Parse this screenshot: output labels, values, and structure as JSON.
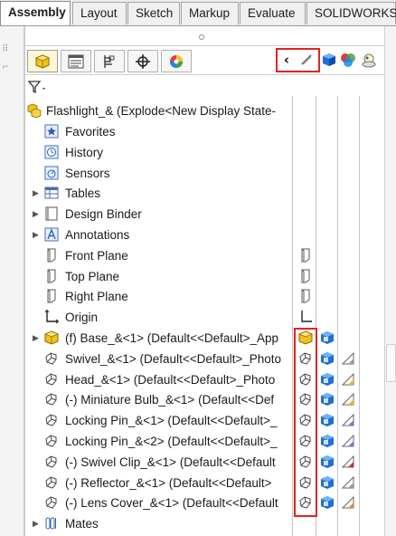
{
  "tabs": [
    "Assembly",
    "Layout",
    "Sketch",
    "Markup",
    "Evaluate",
    "SOLIDWORKS"
  ],
  "active_tab": "Assembly",
  "manager_tabs": [
    {
      "name": "featuremanager-tab-icon",
      "active": true
    },
    {
      "name": "propertymanager-tab-icon",
      "active": false
    },
    {
      "name": "configurationmanager-tab-icon",
      "active": false
    },
    {
      "name": "dimxpertmanager-tab-icon",
      "active": false
    },
    {
      "name": "displaymanager-tab-icon",
      "active": false
    }
  ],
  "header_pane_icons": [
    "collapse-chevron-icon",
    "hide-show-icon",
    "display-mode-icon",
    "appearance-icon",
    "transparency-icon"
  ],
  "tree": {
    "root": "Flashlight_&  (Explode<New Display State-",
    "items": [
      {
        "label": "Favorites",
        "icon": "favorites-icon",
        "indent": 1,
        "expander": false
      },
      {
        "label": "History",
        "icon": "history-icon",
        "indent": 1,
        "expander": false
      },
      {
        "label": "Sensors",
        "icon": "sensors-icon",
        "indent": 1,
        "expander": false
      },
      {
        "label": "Tables",
        "icon": "tables-icon",
        "indent": 1,
        "expander": true
      },
      {
        "label": "Design Binder",
        "icon": "design-binder-icon",
        "indent": 1,
        "expander": true
      },
      {
        "label": "Annotations",
        "icon": "annotations-icon",
        "indent": 1,
        "expander": true
      },
      {
        "label": "Front Plane",
        "icon": "plane-icon",
        "indent": 1,
        "expander": false,
        "col1": "plane"
      },
      {
        "label": "Top Plane",
        "icon": "plane-icon",
        "indent": 1,
        "expander": false,
        "col1": "plane"
      },
      {
        "label": "Right Plane",
        "icon": "plane-icon",
        "indent": 1,
        "expander": false,
        "col1": "plane"
      },
      {
        "label": "Origin",
        "icon": "origin-icon",
        "indent": 1,
        "expander": false,
        "col1": "origin"
      },
      {
        "label": "(f) Base_&<1> (Default<<Default>_App",
        "icon": "part-fixed-icon",
        "indent": 1,
        "expander": true,
        "col1": "part-yellow",
        "col2": "cube",
        "col3": ""
      },
      {
        "label": "Swivel_&<1> (Default<<Default>_Photo",
        "icon": "part-icon",
        "indent": 1,
        "expander": false,
        "col1": "part",
        "col2": "cube",
        "col3": "tri-gray"
      },
      {
        "label": "Head_&<1> (Default<<Default>_Photo",
        "icon": "part-icon",
        "indent": 1,
        "expander": false,
        "col1": "part",
        "col2": "cube",
        "col3": "tri-yellow"
      },
      {
        "label": "(-) Miniature Bulb_&<1> (Default<<Def",
        "icon": "part-icon",
        "indent": 1,
        "expander": false,
        "col1": "part",
        "col2": "cube",
        "col3": "tri-yellow"
      },
      {
        "label": "Locking Pin_&<1> (Default<<Default>_",
        "icon": "part-icon",
        "indent": 1,
        "expander": false,
        "col1": "part",
        "col2": "cube",
        "col3": "tri-purple"
      },
      {
        "label": "Locking Pin_&<2> (Default<<Default>_",
        "icon": "part-icon",
        "indent": 1,
        "expander": false,
        "col1": "part",
        "col2": "cube",
        "col3": "tri-purple"
      },
      {
        "label": "(-) Swivel Clip_&<1> (Default<<Default",
        "icon": "part-icon",
        "indent": 1,
        "expander": false,
        "col1": "part",
        "col2": "cube",
        "col3": "tri-red"
      },
      {
        "label": "(-) Reflector_&<1> (Default<<Default>",
        "icon": "part-icon",
        "indent": 1,
        "expander": false,
        "col1": "part",
        "col2": "cube",
        "col3": "tri-gray"
      },
      {
        "label": "(-) Lens Cover_&<1> (Default<<Default",
        "icon": "part-icon",
        "indent": 1,
        "expander": false,
        "col1": "part",
        "col2": "cube",
        "col3": "tri-orange"
      },
      {
        "label": "Mates",
        "icon": "mates-icon",
        "indent": 1,
        "expander": true
      }
    ]
  },
  "colors": {
    "highlight_red": "#e02424",
    "part_yellow": "#f2c21b",
    "cube_blue": "#1f6fd6",
    "tab_active_bg": "#ffffff"
  }
}
